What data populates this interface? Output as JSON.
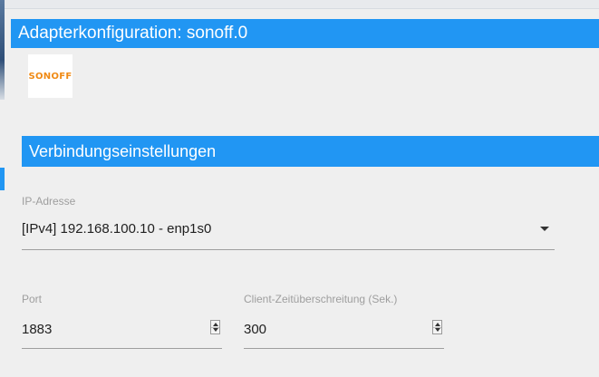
{
  "dialog": {
    "title": "Adapterkonfiguration: sonoff.0"
  },
  "logo": {
    "text": "SONOFF",
    "color": "#f08a14",
    "icon": "sonoff-logo"
  },
  "section": {
    "title": "Verbindungseinstellungen"
  },
  "ip_address": {
    "label": "IP-Adresse",
    "value": "[IPv4] 192.168.100.10 - enp1s0"
  },
  "port": {
    "label": "Port",
    "value": "1883"
  },
  "timeout": {
    "label": "Client-Zeitüberschreitung (Sek.)",
    "value": "300"
  },
  "colors": {
    "accent": "#2196f3",
    "background": "#efefef"
  }
}
